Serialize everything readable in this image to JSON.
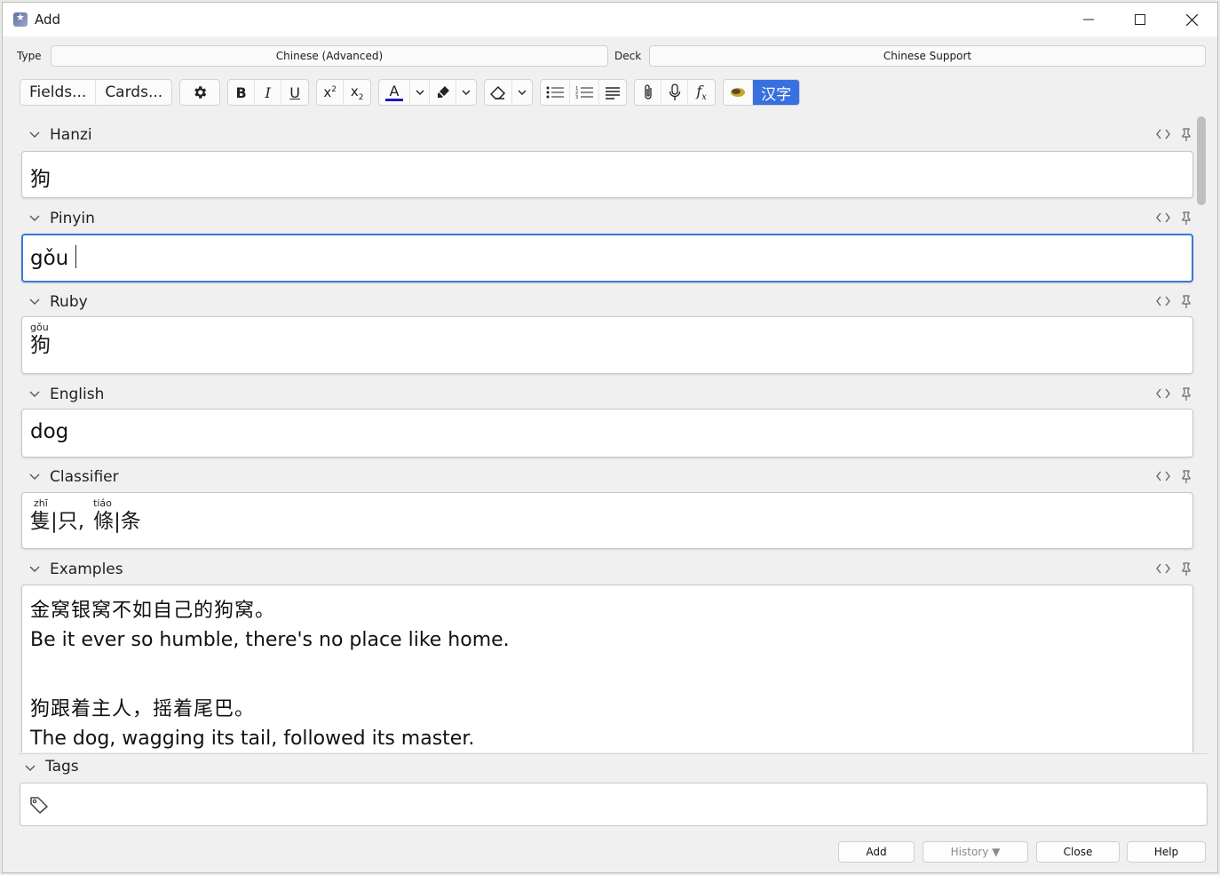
{
  "window": {
    "title": "Add"
  },
  "topbar": {
    "type_label": "Type",
    "type_value": "Chinese (Advanced)",
    "deck_label": "Deck",
    "deck_value": "Chinese Support"
  },
  "toolbar": {
    "fields_label": "Fields...",
    "cards_label": "Cards...",
    "bold": "B",
    "italic": "I",
    "underline": "U",
    "hanzi_label": "汉字",
    "text_color": "#1a1ac8"
  },
  "fields": [
    {
      "name": "Hanzi",
      "value": "狗"
    },
    {
      "name": "Pinyin",
      "value": "gǒu"
    },
    {
      "name": "Ruby",
      "ruby_top": "gǒu",
      "ruby_base": "狗"
    },
    {
      "name": "English",
      "value": "dog"
    },
    {
      "name": "Classifier",
      "ruby1_top": "zhī",
      "ruby1_base": "隻|只",
      "sep": ",",
      "ruby2_top": "tiáo",
      "ruby2_base": "條|条"
    },
    {
      "name": "Examples",
      "lines": [
        "金窝银窝不如自己的狗窝。",
        "Be it ever so humble, there's no place like home.",
        "狗跟着主人，摇着尾巴。",
        "The dog, wagging its tail, followed its master."
      ]
    }
  ],
  "tags": {
    "label": "Tags"
  },
  "buttons": {
    "add": "Add",
    "history": "History ▼",
    "close": "Close",
    "help": "Help"
  },
  "colors": {
    "focus": "#3a78d6",
    "hanzi_button": "#3870e0"
  }
}
